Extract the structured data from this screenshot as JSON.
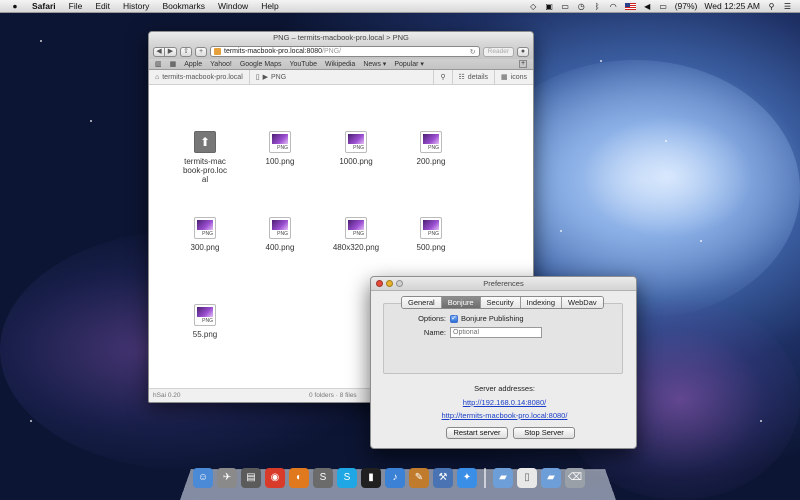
{
  "menubar": {
    "app": "Safari",
    "items": [
      "File",
      "Edit",
      "History",
      "Bookmarks",
      "Window",
      "Help"
    ],
    "battery": "(97%)",
    "clock": "Wed 12:25 AM"
  },
  "browser": {
    "title": "PNG – termits-macbook-pro.local > PNG",
    "url_host": "termits-macbook-pro.local:8080",
    "url_path": "/PNG/",
    "reader": "Reader",
    "bookmarks": [
      "Apple",
      "Yahoo!",
      "Google Maps",
      "YouTube",
      "Wikipedia",
      "News ▾",
      "Popular ▾"
    ],
    "breadcrumbs": [
      "termits-macbook-pro.local",
      "PNG"
    ],
    "view_buttons": [
      "details",
      "icons"
    ],
    "files": [
      {
        "name": "termits-macbook-pro.local",
        "kind": "parent"
      },
      {
        "name": "100.png",
        "kind": "png"
      },
      {
        "name": "1000.png",
        "kind": "png"
      },
      {
        "name": "200.png",
        "kind": "png"
      },
      {
        "name": "300.png",
        "kind": "png"
      },
      {
        "name": "400.png",
        "kind": "png"
      },
      {
        "name": "480x320.png",
        "kind": "png"
      },
      {
        "name": "500.png",
        "kind": "png"
      },
      {
        "name": "55.png",
        "kind": "png"
      }
    ],
    "thumb_label": "PNG",
    "status_left": "hSai 0.20",
    "status_center": "0 folders · 8 files"
  },
  "prefs": {
    "title": "Preferences",
    "tabs": [
      "General",
      "Bonjure",
      "Security",
      "Indexing",
      "WebDav"
    ],
    "active_tab": "Bonjure",
    "options_label": "Options:",
    "bonjour_publishing": "Bonjure Publishing",
    "name_label": "Name:",
    "name_placeholder": "Optional",
    "server_heading": "Server addresses:",
    "addresses": [
      "http://192.168.0.14:8080/",
      "http://termits-macbook-pro.local:8080/"
    ],
    "restart_label": "Restart server",
    "stop_label": "Stop Server"
  },
  "dock": {
    "icons": [
      {
        "name": "finder-icon",
        "color": "#4a8ad6",
        "glyph": "☺"
      },
      {
        "name": "launchpad-icon",
        "color": "#8a8a8a",
        "glyph": "✈"
      },
      {
        "name": "photo-booth-icon",
        "color": "#5b5b5b",
        "glyph": "▤"
      },
      {
        "name": "chrome-icon",
        "color": "#d93b2b",
        "glyph": "◉"
      },
      {
        "name": "firefox-icon",
        "color": "#e0781e",
        "glyph": "◐"
      },
      {
        "name": "sublime-icon",
        "color": "#6b6b6b",
        "glyph": "S"
      },
      {
        "name": "skype-icon",
        "color": "#1ea7e4",
        "glyph": "S"
      },
      {
        "name": "terminal-icon",
        "color": "#202020",
        "glyph": "▮"
      },
      {
        "name": "itunes-icon",
        "color": "#3b82d6",
        "glyph": "♪"
      },
      {
        "name": "growl-icon",
        "color": "#c07b2c",
        "glyph": "✎"
      },
      {
        "name": "xcode-icon",
        "color": "#4a73b3",
        "glyph": "⚒"
      },
      {
        "name": "safari-icon",
        "color": "#3a8ee6",
        "glyph": "✦"
      },
      {
        "name": "applications-folder-icon",
        "color": "#6d9ed8",
        "glyph": "▰"
      },
      {
        "name": "documents-folder-icon",
        "color": "#e8e8e8",
        "glyph": "▯"
      },
      {
        "name": "downloads-folder-icon",
        "color": "#6d9ed8",
        "glyph": "▰"
      },
      {
        "name": "trash-icon",
        "color": "#9aa0a8",
        "glyph": "⌫"
      }
    ]
  }
}
